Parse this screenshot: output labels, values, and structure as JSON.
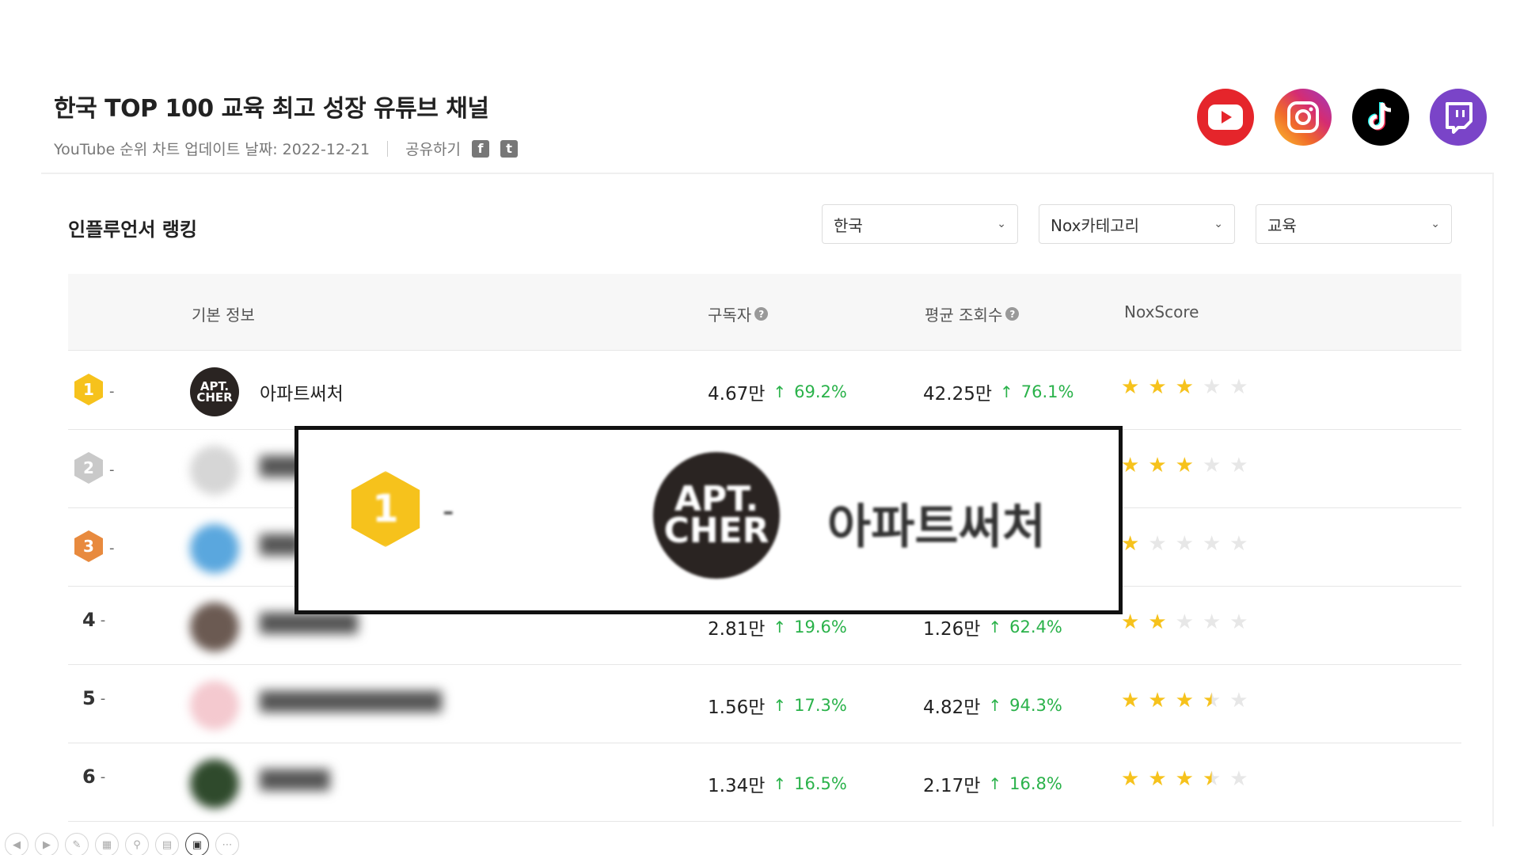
{
  "header": {
    "title": "한국 TOP 100 교육 최고 성장 유튜브 채널",
    "update_text": "YouTube 순위 차트 업데이트 날짜: 2022-12-21",
    "share_label": "공유하기"
  },
  "social_icons": [
    "youtube-icon",
    "instagram-icon",
    "tiktok-icon",
    "twitch-icon"
  ],
  "section_title": "인플루언서 랭킹",
  "filters": {
    "country": "한국",
    "category_type": "Nox카테고리",
    "category": "교육"
  },
  "table": {
    "headers": {
      "basic_info": "기본 정보",
      "subscribers": "구독자",
      "avg_views": "평균 조회수",
      "noxscore": "NoxScore"
    },
    "rows": [
      {
        "rank": "1",
        "name": "아파트써처",
        "subs": "4.67만",
        "subs_growth": "69.2%",
        "views": "42.25만",
        "views_growth": "76.1%",
        "stars": 3
      },
      {
        "rank": "2",
        "name": "",
        "subs": "",
        "subs_growth": "",
        "views": "",
        "views_growth": "",
        "stars": 3
      },
      {
        "rank": "3",
        "name": "",
        "subs": "",
        "subs_growth": "",
        "views": "",
        "views_growth": "",
        "stars": 1
      },
      {
        "rank": "4",
        "name": "",
        "subs": "2.81만",
        "subs_growth": "19.6%",
        "views": "1.26만",
        "views_growth": "62.4%",
        "stars": 2
      },
      {
        "rank": "5",
        "name": "",
        "subs": "1.56만",
        "subs_growth": "17.3%",
        "views": "4.82만",
        "views_growth": "94.3%",
        "stars": 3.5
      },
      {
        "rank": "6",
        "name": "",
        "subs": "1.34만",
        "subs_growth": "16.5%",
        "views": "2.17만",
        "views_growth": "16.8%",
        "stars": 3.5
      }
    ]
  },
  "zoom_callout": {
    "rank": "1",
    "name": "아파트써처"
  },
  "avatar_text": {
    "line1": "APT.",
    "line2": "CHER"
  },
  "colors": {
    "growth": "#2ab24a",
    "star": "#f6c21c",
    "gold": "#f6c21c",
    "silver": "#c9c9c9",
    "bronze": "#e88a3e"
  }
}
